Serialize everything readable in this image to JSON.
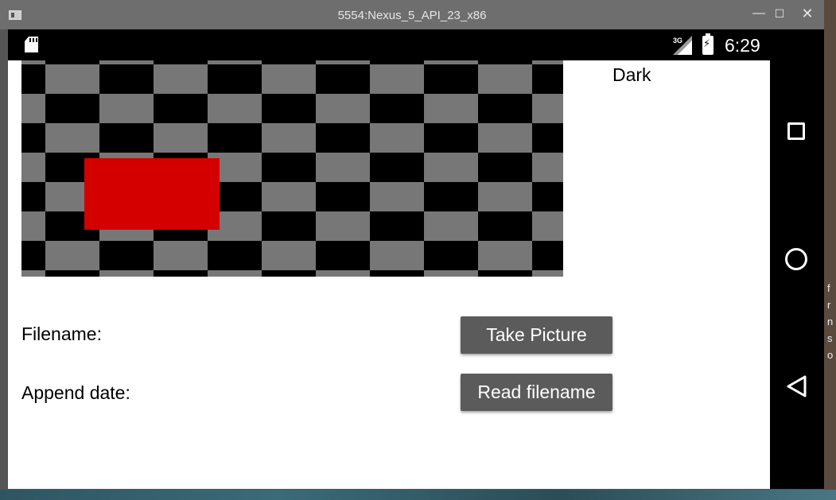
{
  "window": {
    "title": "5554:Nexus_5_API_23_x86",
    "minimize": "—",
    "maximize": "☐",
    "close": "✕"
  },
  "statusbar": {
    "network": "3G",
    "time": "6:29"
  },
  "icons": {
    "sd": "sd-card-icon",
    "signal": "signal-icon",
    "battery": "battery-charging-icon",
    "recent": "recent-apps-icon",
    "home": "home-icon",
    "back": "back-icon"
  },
  "app": {
    "mode_label": "Dark",
    "filename_label": "Filename:",
    "append_date_label": "Append date:",
    "take_picture_label": "Take Picture",
    "read_filename_label": "Read filename"
  },
  "desktop": {
    "right_edge_text": [
      "f",
      "r",
      "n",
      "s",
      "o"
    ]
  },
  "colors": {
    "checker_dark": "#000000",
    "checker_light": "#777777",
    "overlay": "#d40000",
    "button": "#5b5b5b"
  }
}
